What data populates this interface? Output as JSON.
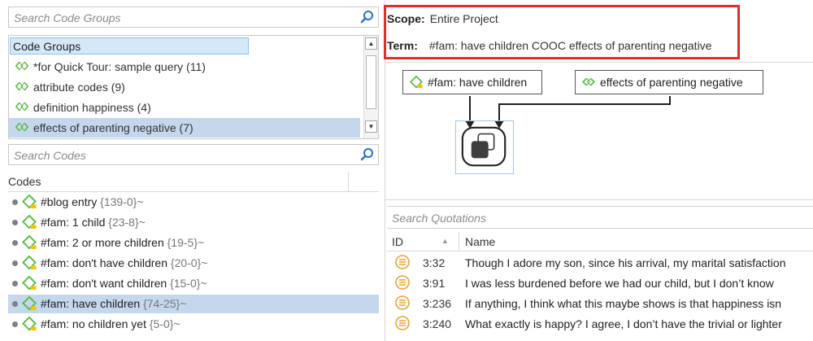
{
  "code_groups_search": {
    "placeholder": "Search Code Groups",
    "icon": "search-icon"
  },
  "code_groups": {
    "header": "Code Groups",
    "items": [
      {
        "label": "*for Quick Tour: sample query (11)",
        "selected": false
      },
      {
        "label": "attribute codes (9)",
        "selected": false
      },
      {
        "label": "definition happiness (4)",
        "selected": false
      },
      {
        "label": "effects of parenting negative (7)",
        "selected": true
      }
    ]
  },
  "codes_search": {
    "placeholder": "Search Codes",
    "icon": "search-icon"
  },
  "codes": {
    "header": "Codes",
    "items": [
      {
        "name": "#blog entry",
        "count": "{139-0}~",
        "selected": false
      },
      {
        "name": "#fam: 1 child",
        "count": "{23-8}~",
        "selected": false
      },
      {
        "name": "#fam: 2 or more  children",
        "count": "{19-5}~",
        "selected": false
      },
      {
        "name": "#fam: don't have children",
        "count": "{20-0}~",
        "selected": false
      },
      {
        "name": "#fam: don't want children",
        "count": "{15-0}~",
        "selected": false
      },
      {
        "name": "#fam: have children",
        "count": "{74-25}~",
        "selected": true
      },
      {
        "name": "#fam: no children yet",
        "count": "{5-0}~",
        "selected": false
      }
    ]
  },
  "query": {
    "scope_label": "Scope:",
    "scope_value": "Entire Project",
    "term_label": "Term:",
    "term_value": "#fam: have children COOC effects of parenting negative"
  },
  "diagram": {
    "node_code": "#fam: have children",
    "node_group": "effects of parenting negative",
    "operator_icon": "cooccurrence-operator-icon"
  },
  "quotations_search": {
    "placeholder": "Search Quotations"
  },
  "quotations": {
    "col_id": "ID",
    "col_name": "Name",
    "rows": [
      {
        "id": "3:32",
        "text": "Though I adore my son, since his arrival, my marital satisfaction"
      },
      {
        "id": "3:91",
        "text": "I was less burdened before we had our child, but I don’t know"
      },
      {
        "id": "3:236",
        "text": "If anything, I think what this maybe shows is that happiness isn"
      },
      {
        "id": "3:240",
        "text": "What exactly is happy? I agree, I don’t have the trivial or lighter"
      }
    ]
  },
  "colors": {
    "highlight_border": "#e02d2d",
    "selection": "#c4d7ec",
    "code_icon_green": "#5bb947",
    "code_icon_yellow": "#f1c40f",
    "quote_icon": "#e8a33a"
  }
}
